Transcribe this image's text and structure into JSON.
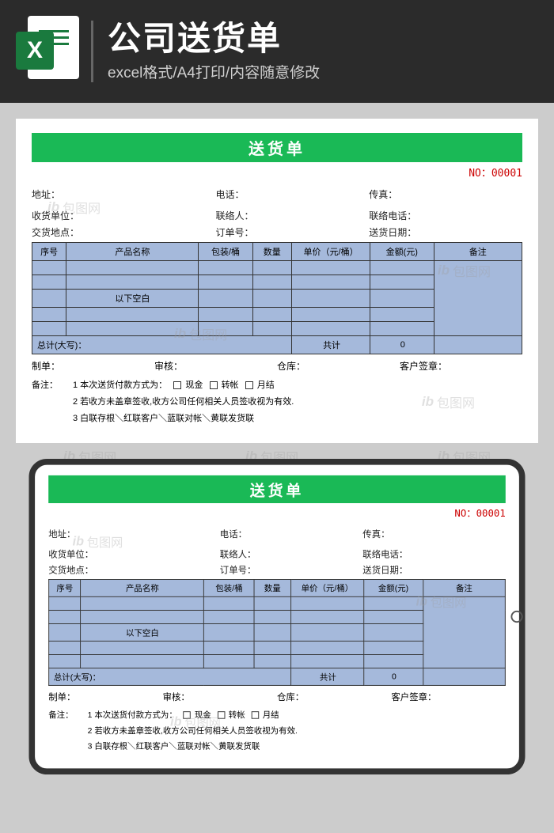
{
  "header": {
    "icon_letter": "X",
    "main_title": "公司送货单",
    "sub_title": "excel格式/A4打印/内容随意修改"
  },
  "sheet": {
    "title": "送货单",
    "serial": "NO：00001",
    "row1": {
      "address_label": "地址：",
      "phone_label": "电话：",
      "fax_label": "传真："
    },
    "row2": {
      "recv_label": "收货单位：",
      "contact_label": "联络人：",
      "tel_label": "联络电话："
    },
    "row3": {
      "loc_label": "交货地点：",
      "order_label": "订单号：",
      "date_label": "送货日期："
    },
    "cols": {
      "c1": "序号",
      "c2": "产品名称",
      "c3": "包装/桶",
      "c4": "数量",
      "c5": "单价（元/桶）",
      "c6": "金额(元)",
      "c7": "备注"
    },
    "blank_below": "以下空白",
    "total_label": "总计(大写)：",
    "sum_label": "共计",
    "sum_value": "0",
    "sign": {
      "maker": "制单：",
      "auditor": "审核：",
      "warehouse": "仓库：",
      "customer": "客户签章："
    },
    "notes_label": "备注：",
    "note1_prefix": "1 本次送货付款方式为：",
    "note1_opt1": "现金",
    "note1_opt2": "转帐",
    "note1_opt3": "月结",
    "note2": "2 若收方未盖章签收,收方公司任何相关人员签收视为有效.",
    "note3": "3 白联存根＼红联客户＼蓝联对帐＼黄联发货联"
  },
  "watermark": "包图网"
}
